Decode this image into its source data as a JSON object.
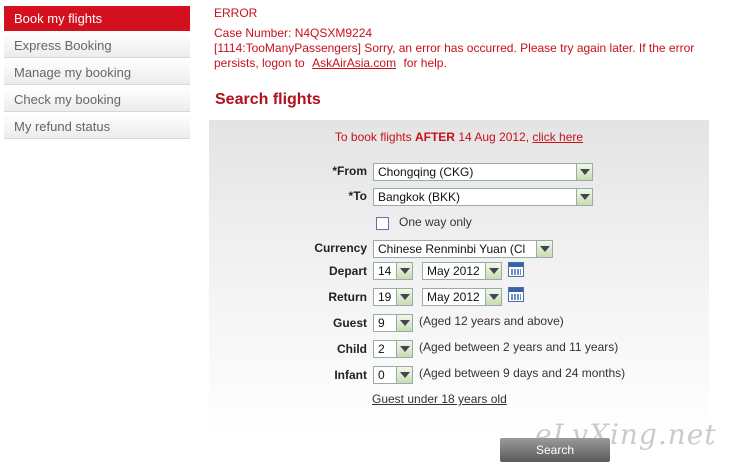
{
  "sidebar": {
    "items": [
      {
        "label": "Book my flights"
      },
      {
        "label": "Express Booking"
      },
      {
        "label": "Manage my booking"
      },
      {
        "label": "Check my booking"
      },
      {
        "label": "My refund status"
      }
    ]
  },
  "error": {
    "title": "ERROR",
    "case_number": "Case Number: N4QSXM9224",
    "message_prefix": "[1114:TooManyPassengers] Sorry, an error has occurred. Please try again later. If the error persists, logon to",
    "link_text": "AskAirAsia.com",
    "message_suffix": "for help."
  },
  "section_title": "Search flights",
  "notice": {
    "prefix": "To book flights",
    "bold": "AFTER",
    "date": "14 Aug 2012,",
    "link_text": "click here"
  },
  "form": {
    "from_label": "*From",
    "from_value": "Chongqing (CKG)",
    "to_label": "*To",
    "to_value": "Bangkok (BKK)",
    "oneway_label": "One way only",
    "currency_label": "Currency",
    "currency_value": "Chinese Renminbi Yuan (Cl",
    "depart_label": "Depart",
    "depart_day": "14",
    "depart_month": "May 2012",
    "return_label": "Return",
    "return_day": "19",
    "return_month": "May 2012",
    "guest_label": "Guest",
    "guest_value": "9",
    "guest_hint": "(Aged 12 years and above)",
    "child_label": "Child",
    "child_value": "2",
    "child_hint": "(Aged between 2 years and 11 years)",
    "infant_label": "Infant",
    "infant_value": "0",
    "infant_hint": "(Aged between 9 days and 24 months)",
    "guest_under_link": "Guest under 18 years old"
  },
  "search_button": "Search",
  "watermark": "eLvXing.net",
  "colors": {
    "accent": "#d5101e",
    "error_text": "#c8101b"
  }
}
